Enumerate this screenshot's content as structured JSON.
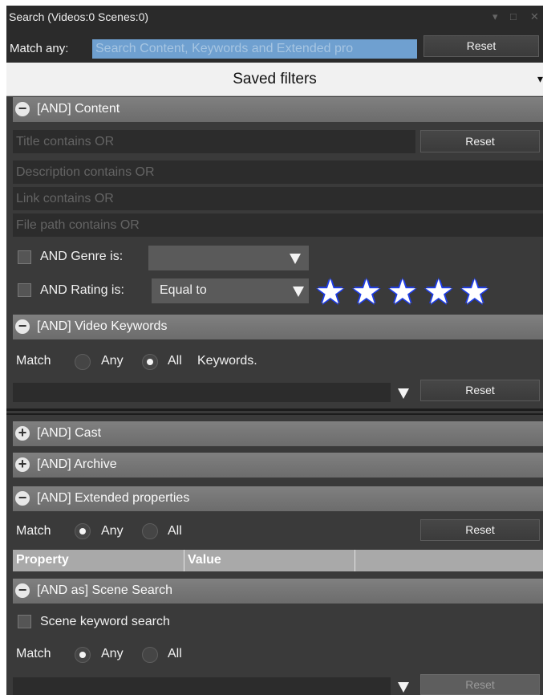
{
  "window": {
    "title": "Search (Videos:0 Scenes:0)",
    "minimize_glyph": "▾",
    "maximize_glyph": "□",
    "close_glyph": "✕"
  },
  "top": {
    "match_label": "Match any:",
    "search_placeholder": "Search Content, Keywords and Extended pro",
    "reset_label": "Reset"
  },
  "saved_filters": {
    "label": "Saved filters",
    "caret": "▾"
  },
  "content": {
    "icon": "−",
    "header": "[AND] Content",
    "title_placeholder": "Title contains OR",
    "title_reset": "Reset",
    "description_placeholder": "Description contains OR",
    "link_placeholder": "Link contains OR",
    "filepath_placeholder": "File path contains OR",
    "genre_label": "AND Genre is:",
    "genre_value": "",
    "rating_label": "AND Rating is:",
    "rating_value": "Equal to",
    "rating_stars": 5,
    "star_glyph": "★"
  },
  "video_keywords": {
    "icon": "−",
    "header": "[AND] Video Keywords",
    "match_label": "Match",
    "any_label": "Any",
    "all_label": "All",
    "suffix_label": "Keywords.",
    "selected": "All",
    "reset_label": "Reset"
  },
  "cast": {
    "icon": "+",
    "header": "[AND] Cast"
  },
  "archive": {
    "icon": "+",
    "header": "[AND] Archive"
  },
  "extended": {
    "icon": "−",
    "header": "[AND] Extended properties",
    "match_label": "Match",
    "any_label": "Any",
    "all_label": "All",
    "selected": "Any",
    "reset_label": "Reset",
    "columns": [
      "Property",
      "Value"
    ]
  },
  "scene_search": {
    "icon": "−",
    "header": "[AND as] Scene Search",
    "checkbox_label": "Scene keyword search",
    "match_label": "Match",
    "any_label": "Any",
    "all_label": "All",
    "selected": "Any",
    "reset_label": "Reset"
  },
  "colors": {
    "panel": "#3a3a3a",
    "section_header": "#777777",
    "star_fill": "#ffffff",
    "star_outline": "#1f3ee8",
    "search_field": "#6fa0d0"
  }
}
